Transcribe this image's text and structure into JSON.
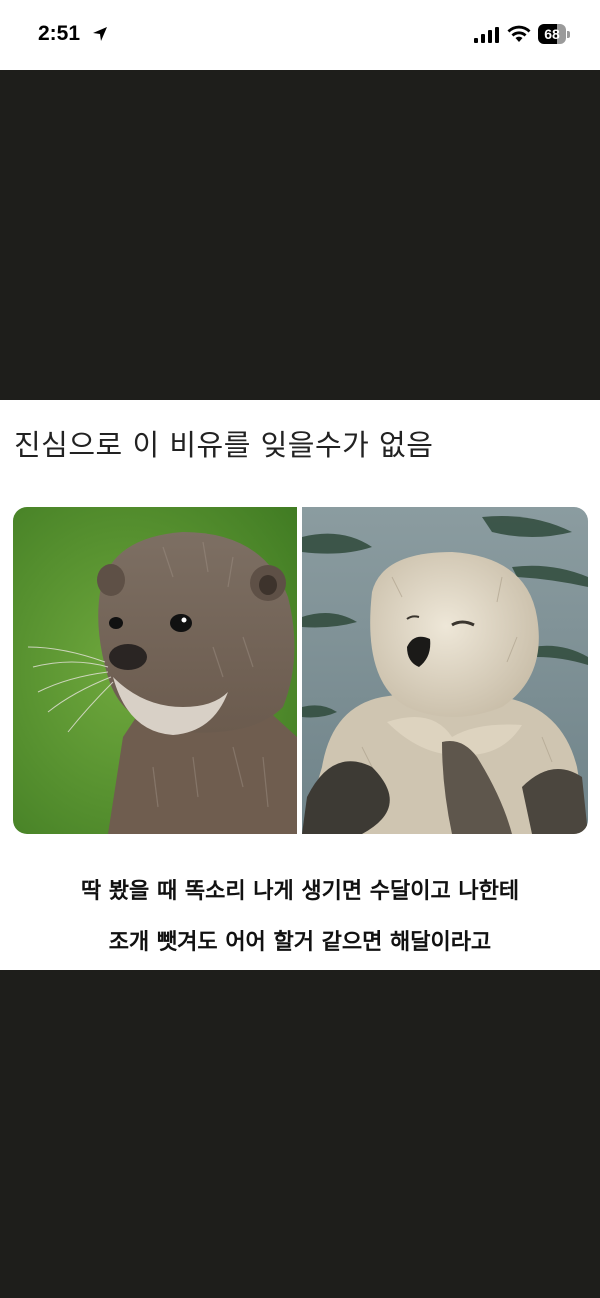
{
  "status_bar": {
    "time": "2:51",
    "battery_level": "68",
    "icons": [
      "location-arrow-icon",
      "cellular-signal-icon",
      "wifi-icon",
      "battery-icon"
    ]
  },
  "post": {
    "headline": "진심으로 이 비유를 잊을수가 없음",
    "caption_line_1": "딱 봤을 때 똑소리 나게 생기면 수달이고 나한테",
    "caption_line_2": "조개 뺏겨도 어어 할거 같으면 해달이라고"
  },
  "colors": {
    "background": "#1e1e1b",
    "card": "#ffffff",
    "text": "#111111"
  }
}
